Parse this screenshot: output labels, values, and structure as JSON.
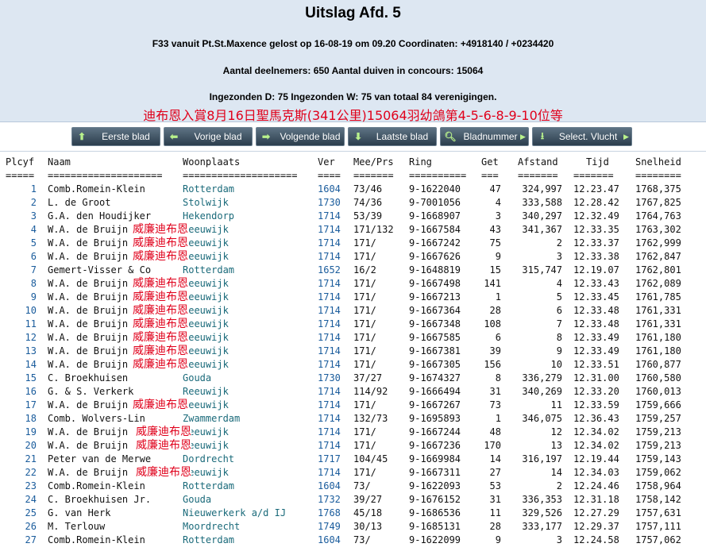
{
  "header": {
    "title": "Uitslag Afd. 5",
    "line1": "F33 vanuit Pt.St.Maxence gelost op 16-08-19 om 09.20 Coordinaten: +4918140 / +0234420",
    "line2": "Aantal deelnemers: 650 Aantal duiven in concours: 15064",
    "line3": "Ingezonden D: 75 Ingezonden W: 75 van totaal 84 verenigingen.",
    "chinese": "迪布恩入賞8月16日聖馬克斯(341公里)15064羽幼鴿第4-5-6-8-9-10位等"
  },
  "toolbar": [
    {
      "label": "Eerste blad",
      "icon": "arrow-up-icon"
    },
    {
      "label": "Vorige blad",
      "icon": "arrow-left-icon"
    },
    {
      "label": "Volgende blad",
      "icon": "arrow-right-icon"
    },
    {
      "label": "Laatste blad",
      "icon": "arrow-down-icon"
    },
    {
      "label": "Bladnummer",
      "icon": "search-icon"
    },
    {
      "label": "Select. Vlucht",
      "icon": "download-icon"
    }
  ],
  "table": {
    "headers": [
      "Plcyf",
      "Naam",
      "Woonplaats",
      "Ver",
      "Mee/Prs",
      "Ring",
      "Get",
      "Afstand",
      "Tijd",
      "Snelheid"
    ],
    "separators": [
      "=====",
      "====================",
      "====================",
      "====",
      "=======",
      "==========",
      "===",
      "=======",
      "=======",
      "========"
    ],
    "overlay_text": "威廉迪布恩",
    "rows": [
      [
        "1",
        "Comb.Romein-Klein",
        "Rotterdam",
        "1604",
        "73/46",
        "9-1622040",
        "47",
        "324,997",
        "12.23.47",
        "1768,375"
      ],
      [
        "2",
        "L. de Groot",
        "Stolwijk",
        "1730",
        "74/36",
        "9-7001056",
        "4",
        "333,588",
        "12.28.42",
        "1767,825"
      ],
      [
        "3",
        "G.A. den Houdijker",
        "Hekendorp",
        "1714",
        "53/39",
        "9-1668907",
        "3",
        "340,297",
        "12.32.49",
        "1764,763"
      ],
      [
        "4",
        "W.A. de Bruijn",
        "Reeuwijk",
        "1714",
        "171/132",
        "9-1667584",
        "43",
        "341,367",
        "12.33.35",
        "1763,302"
      ],
      [
        "5",
        "W.A. de Bruijn",
        "Reeuwijk",
        "1714",
        "171/",
        "9-1667242",
        "75",
        "2",
        "12.33.37",
        "1762,999"
      ],
      [
        "6",
        "W.A. de Bruijn",
        "Reeuwijk",
        "1714",
        "171/",
        "9-1667626",
        "9",
        "3",
        "12.33.38",
        "1762,847"
      ],
      [
        "7",
        "Gemert-Visser & Co",
        "Rotterdam",
        "1652",
        "16/2",
        "9-1648819",
        "15",
        "315,747",
        "12.19.07",
        "1762,801"
      ],
      [
        "8",
        "W.A. de Bruijn",
        "Reeuwijk",
        "1714",
        "171/",
        "9-1667498",
        "141",
        "4",
        "12.33.43",
        "1762,089"
      ],
      [
        "9",
        "W.A. de Bruijn",
        "Reeuwijk",
        "1714",
        "171/",
        "9-1667213",
        "1",
        "5",
        "12.33.45",
        "1761,785"
      ],
      [
        "10",
        "W.A. de Bruijn",
        "Reeuwijk",
        "1714",
        "171/",
        "9-1667364",
        "28",
        "6",
        "12.33.48",
        "1761,331"
      ],
      [
        "11",
        "W.A. de Bruijn",
        "Reeuwijk",
        "1714",
        "171/",
        "9-1667348",
        "108",
        "7",
        "12.33.48",
        "1761,331"
      ],
      [
        "12",
        "W.A. de Bruijn",
        "Reeuwijk",
        "1714",
        "171/",
        "9-1667585",
        "6",
        "8",
        "12.33.49",
        "1761,180"
      ],
      [
        "13",
        "W.A. de Bruijn",
        "Reeuwijk",
        "1714",
        "171/",
        "9-1667381",
        "39",
        "9",
        "12.33.49",
        "1761,180"
      ],
      [
        "14",
        "W.A. de Bruijn",
        "Reeuwijk",
        "1714",
        "171/",
        "9-1667305",
        "156",
        "10",
        "12.33.51",
        "1760,877"
      ],
      [
        "15",
        "C. Broekhuisen",
        "Gouda",
        "1730",
        "37/27",
        "9-1674327",
        "8",
        "336,279",
        "12.31.00",
        "1760,580"
      ],
      [
        "16",
        "G. & S. Verkerk",
        "Reeuwijk",
        "1714",
        "114/92",
        "9-1666494",
        "31",
        "340,269",
        "12.33.20",
        "1760,013"
      ],
      [
        "17",
        "W.A. de Bruijn",
        "Reeuwijk",
        "1714",
        "171/",
        "9-1667267",
        "73",
        "11",
        "12.33.59",
        "1759,666"
      ],
      [
        "18",
        "Comb. Wolvers-Lin",
        "Zwammerdam",
        "1714",
        "132/73",
        "9-1695893",
        "1",
        "346,075",
        "12.36.43",
        "1759,257"
      ],
      [
        "19",
        "W.A. de Bruijn",
        "Reeuwijk",
        "1714",
        "171/",
        "9-1667244",
        "48",
        "12",
        "12.34.02",
        "1759,213"
      ],
      [
        "20",
        "W.A. de Bruijn",
        "Reeuwijk",
        "1714",
        "171/",
        "9-1667236",
        "170",
        "13",
        "12.34.02",
        "1759,213"
      ],
      [
        "21",
        "Peter van de Merwe",
        "Dordrecht",
        "1717",
        "104/45",
        "9-1669984",
        "14",
        "316,197",
        "12.19.44",
        "1759,143"
      ],
      [
        "22",
        "W.A. de Bruijn",
        "Reeuwijk",
        "1714",
        "171/",
        "9-1667311",
        "27",
        "14",
        "12.34.03",
        "1759,062"
      ],
      [
        "23",
        "Comb.Romein-Klein",
        "Rotterdam",
        "1604",
        "73/",
        "9-1622093",
        "53",
        "2",
        "12.24.46",
        "1758,964"
      ],
      [
        "24",
        "C. Broekhuisen Jr.",
        "Gouda",
        "1732",
        "39/27",
        "9-1676152",
        "31",
        "336,353",
        "12.31.18",
        "1758,142"
      ],
      [
        "25",
        "G. van Herk",
        "Nieuwerkerk a/d IJ",
        "1768",
        "45/18",
        "9-1686536",
        "11",
        "329,526",
        "12.27.29",
        "1757,631"
      ],
      [
        "26",
        "M. Terlouw",
        "Moordrecht",
        "1749",
        "30/13",
        "9-1685131",
        "28",
        "333,177",
        "12.29.37",
        "1757,111"
      ],
      [
        "27",
        "Comb.Romein-Klein",
        "Rotterdam",
        "1604",
        "73/",
        "9-1622099",
        "9",
        "3",
        "12.24.58",
        "1757,062"
      ]
    ]
  }
}
